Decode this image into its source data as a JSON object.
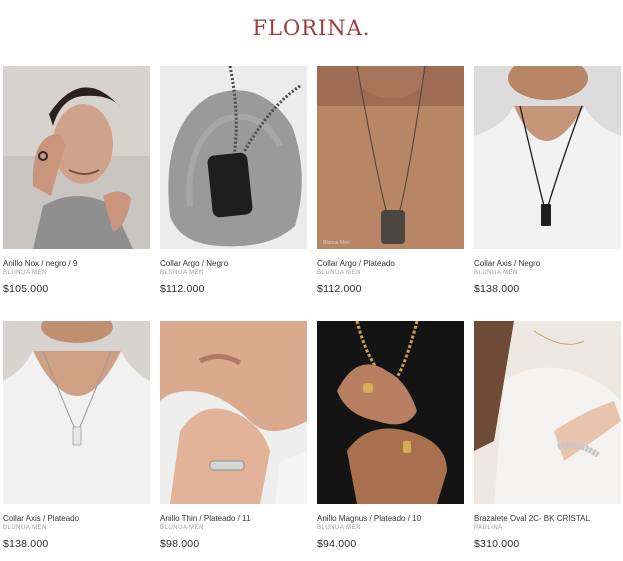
{
  "brand": {
    "logo_text": "FLORINA.",
    "logo_color": "#9c3b3e"
  },
  "products": [
    {
      "name": "Anillo Nox / negro / 9",
      "brand": "BLUNUA MEN",
      "price": "$105.000",
      "image": "man-face-ring-photo"
    },
    {
      "name": "Collar Argo / Negro",
      "brand": "BLUNUA MEN",
      "price": "$112.000",
      "image": "black-dog-tag-on-stone-photo"
    },
    {
      "name": "Collar Argo / Plateado",
      "brand": "BLUNUA MEN",
      "price": "$112.000",
      "image": "dog-tag-on-chest-photo",
      "watermark": "Blunua Men"
    },
    {
      "name": "Collar Axis / Negro",
      "brand": "BLUNUA MEN",
      "price": "$138.000",
      "image": "black-bar-necklace-tank-photo"
    },
    {
      "name": "Collar Axis / Plateado",
      "brand": "BLUNUA MEN",
      "price": "$138.000",
      "image": "silver-bar-necklace-tank-photo"
    },
    {
      "name": "Anillo Thin / Plateado / 11",
      "brand": "BLUNUA MEN",
      "price": "$98.000",
      "image": "silver-band-ring-hand-photo"
    },
    {
      "name": "Anillo Magnus / Plateado / 10",
      "brand": "BLUNUA MEN",
      "price": "$94.000",
      "image": "gold-rings-hands-photo"
    },
    {
      "name": "Brazalete Oval 2C- BK CRISTAL",
      "brand": "PAULINA",
      "price": "$310.000",
      "image": "crystal-bracelet-wrist-photo"
    }
  ]
}
